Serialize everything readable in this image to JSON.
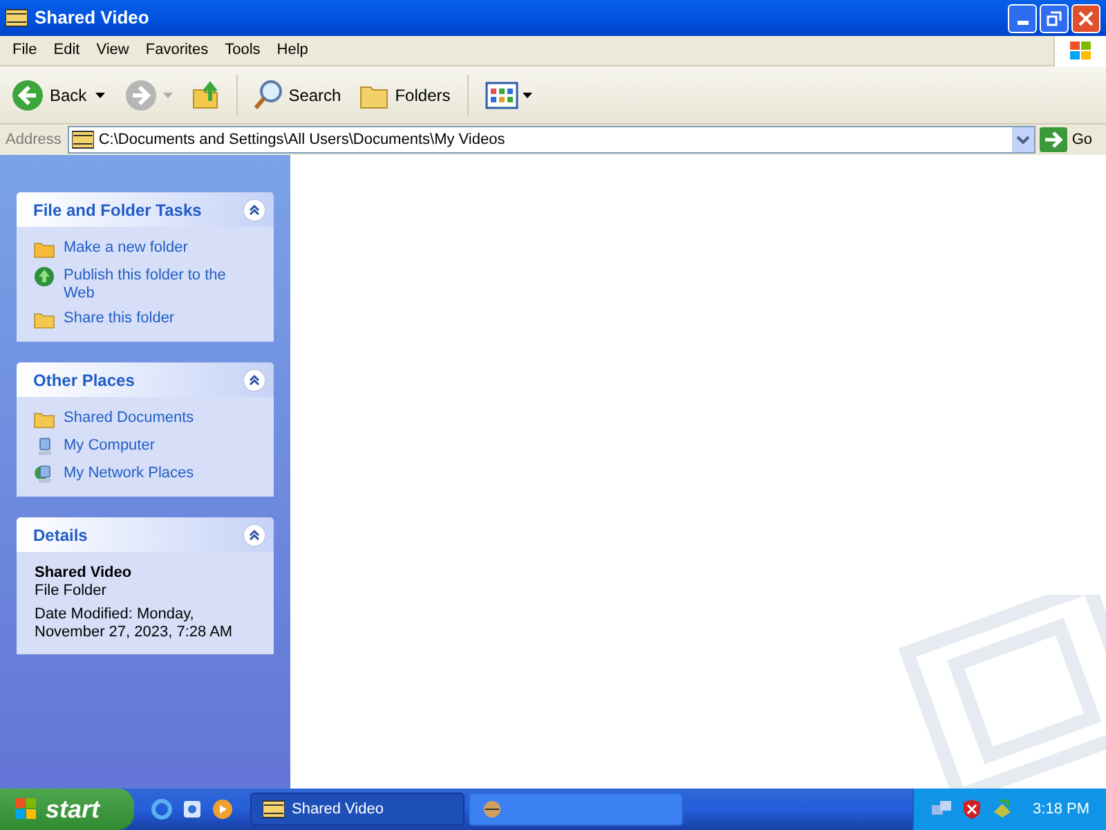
{
  "window": {
    "title": "Shared Video"
  },
  "menu": [
    "File",
    "Edit",
    "View",
    "Favorites",
    "Tools",
    "Help"
  ],
  "toolbar": {
    "back": "Back",
    "search": "Search",
    "folders": "Folders",
    "forward_disabled": true
  },
  "address": {
    "label": "Address",
    "value": "C:\\Documents and Settings\\All Users\\Documents\\My Videos",
    "go": "Go"
  },
  "panels": [
    {
      "kind": "links",
      "title": "File and Folder Tasks",
      "expanded": true,
      "items": [
        "Make a new folder",
        "Publish this folder to the Web",
        "Share this folder"
      ]
    },
    {
      "kind": "links",
      "title": "Other Places",
      "expanded": true,
      "items": [
        "Shared Documents",
        "My Computer",
        "My Network Places"
      ]
    },
    {
      "kind": "details",
      "title": "Details",
      "expanded": true,
      "name": "Shared Video",
      "type": "File Folder",
      "modified": "Date Modified: Monday, November 27, 2023, 7:28 AM"
    }
  ],
  "taskbar": {
    "start": "start",
    "tasks": [
      {
        "label": "Shared Video",
        "selected": true
      },
      {
        "selected": false
      }
    ],
    "clock": "3:18 PM"
  }
}
